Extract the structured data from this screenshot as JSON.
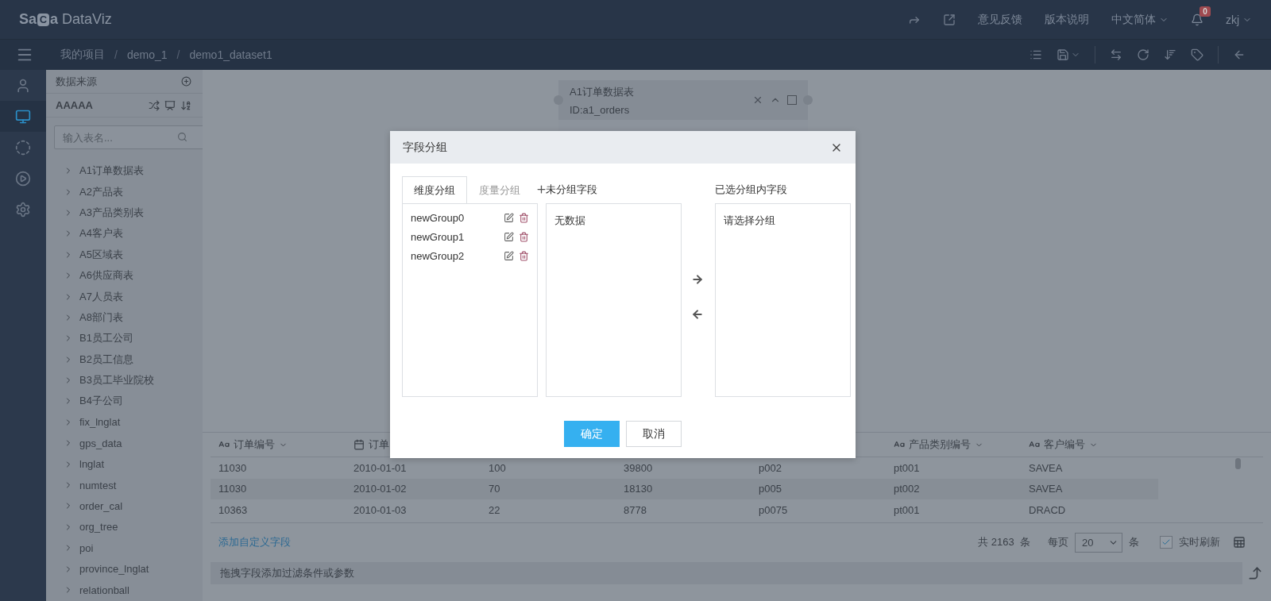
{
  "topbar": {
    "logo": {
      "brand": "Sa",
      "mark": "C",
      "rest": "a",
      "product": "DataViz"
    },
    "links": [
      {
        "kind": "icon"
      },
      {
        "kind": "icon"
      },
      {
        "kind": "text",
        "label": "意见反馈"
      },
      {
        "kind": "text",
        "label": "版本说明"
      },
      {
        "kind": "menu",
        "label": "中文简体"
      },
      {
        "kind": "bell",
        "badge": "0"
      },
      {
        "kind": "menu",
        "label": "zkj"
      }
    ]
  },
  "breadcrumb": [
    {
      "kind": "link",
      "label": "我的项目"
    },
    {
      "kind": "sep",
      "label": "/"
    },
    {
      "kind": "link",
      "label": "demo_1"
    },
    {
      "kind": "sep",
      "label": "/"
    },
    {
      "kind": "link",
      "label": "demo1_dataset1"
    }
  ],
  "toolbar": [
    {
      "kind": "icon"
    },
    {
      "kind": "menu"
    },
    {
      "kind": "sep"
    },
    {
      "kind": "icon"
    },
    {
      "kind": "icon"
    },
    {
      "kind": "icon"
    },
    {
      "kind": "icon"
    },
    {
      "kind": "sep"
    },
    {
      "kind": "icon"
    }
  ],
  "rail": [
    {
      "selected": false
    },
    {
      "selected": true
    },
    {
      "selected": false
    },
    {
      "selected": false
    },
    {
      "selected": false
    }
  ],
  "sidebar": {
    "title": "数据来源",
    "source": "AAAAA",
    "search": {
      "placeholder": "输入表名..."
    },
    "items": [
      "A1订单数据表",
      "A2产品表",
      "A3产品类别表",
      "A4客户表",
      "A5区域表",
      "A6供应商表",
      "A7人员表",
      "A8部门表",
      "B1员工公司",
      "B2员工信息",
      "B3员工毕业院校",
      "B4子公司",
      "fix_lnglat",
      "gps_data",
      "lnglat",
      "numtest",
      "order_cal",
      "org_tree",
      "poi",
      "province_lnglat",
      "relationball"
    ]
  },
  "node": {
    "title": "A1订单数据表",
    "id": "ID:a1_orders",
    "checked": false
  },
  "table": {
    "columns": [
      {
        "kind": "text",
        "label": "订单编号"
      },
      {
        "kind": "date",
        "label": "订单"
      },
      {
        "kind": "hidden"
      },
      {
        "kind": "hidden"
      },
      {
        "kind": "hidden"
      },
      {
        "kind": "text",
        "label": "产品类别编号"
      },
      {
        "kind": "text",
        "label": "客户编号"
      }
    ],
    "rows": [
      [
        "11030",
        "2010-01-01",
        "100",
        "39800",
        "p002",
        "pt001",
        "SAVEA"
      ],
      [
        "11030",
        "2010-01-02",
        "70",
        "18130",
        "p005",
        "pt002",
        "SAVEA"
      ],
      [
        "10363",
        "2010-01-03",
        "22",
        "8778",
        "p0075",
        "pt001",
        "DRACD"
      ]
    ],
    "add_link": "添加自定义字段",
    "total": "共 2163  条",
    "per_page": "每页",
    "page_size": "20",
    "unit": "条",
    "live": {
      "label": "实时刷新",
      "checked": true
    },
    "filter_hint": "拖拽字段添加过滤条件或参数"
  },
  "dialog": {
    "title": "字段分组",
    "tabs": [
      {
        "label": "维度分组",
        "selected": true
      },
      {
        "label": "度量分组",
        "selected": false
      }
    ],
    "groups": [
      "newGroup0",
      "newGroup1",
      "newGroup2"
    ],
    "unassigned": {
      "label": "未分组字段",
      "empty": "无数据"
    },
    "assigned": {
      "label": "已选分组内字段",
      "hint": "请选择分组"
    },
    "confirm": "确定",
    "cancel": "取消"
  }
}
